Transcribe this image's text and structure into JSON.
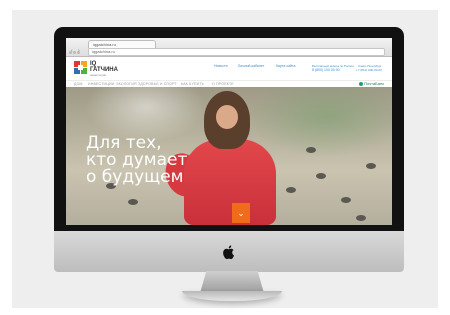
{
  "browser": {
    "tab_title": "iqgatchina.ru",
    "url": "iqgatchina.ru",
    "back_icon": "‹",
    "forward_icon": "›"
  },
  "site": {
    "brand": {
      "line1": "IQ",
      "line2": "ГАТЧИНА",
      "line3": "инвестиции"
    },
    "header_nav": [
      "Новости",
      "Личный кабинет",
      "Карта сайта"
    ],
    "contacts": [
      {
        "label": "Бесплатный звонок по России",
        "phone": "8 (800) 100 00 00"
      },
      {
        "label": "Санкт-Петербург",
        "phone": "+7 (812) 000-00-00"
      }
    ],
    "sub_nav": [
      "ДОМ",
      "ИНВЕСТИЦИИ",
      "ЭКОЛОГИЯ",
      "ЗДОРОВЬЕ И СПОРТ",
      "КАК КУПИТЬ",
      "О ПРОЕКТЕ"
    ],
    "partner_name": "ПочтаБанк",
    "hero_lines": [
      "Для тех,",
      "кто думает",
      "о будущем"
    ],
    "cta_icon": "chevron-double-down-icon",
    "cta_glyph": "⌄"
  },
  "colors": {
    "accent_orange": "#f06b1c",
    "link_blue": "#3c8ec9",
    "dress_red": "#d63a41",
    "partner_green": "#23a06b"
  }
}
